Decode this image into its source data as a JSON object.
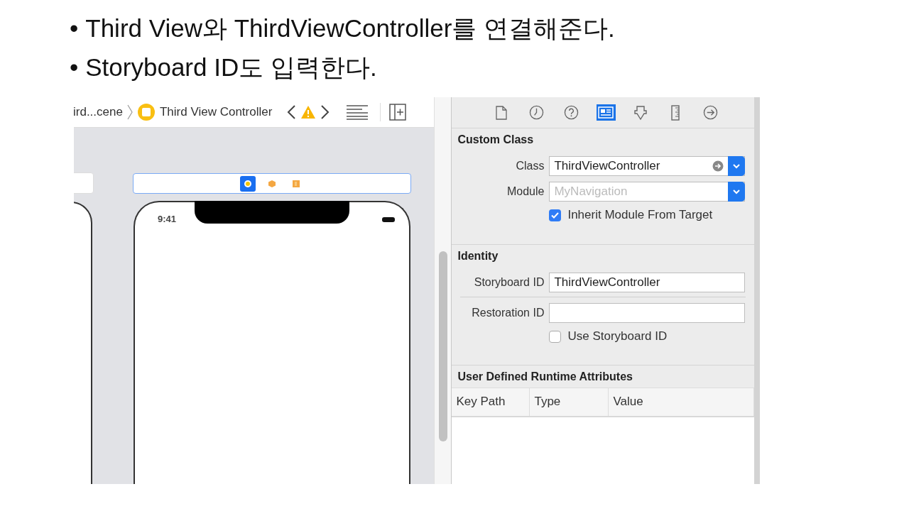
{
  "slide": {
    "bullets": [
      {
        "marker": "•",
        "text": "Third View와 ThirdViewController를 연결해준다."
      },
      {
        "marker": "•",
        "text": "Storyboard ID도 입력한다."
      }
    ]
  },
  "editor": {
    "breadcrumb": [
      "ird...cene",
      "Third View Controller"
    ],
    "dock": [
      {
        "kind": "controller",
        "selected": true
      },
      {
        "kind": "responder",
        "selected": false
      },
      {
        "kind": "exit",
        "selected": false
      }
    ],
    "clock": "9:41"
  },
  "inspector": {
    "tabs": [
      {
        "kind": "file",
        "selected": false
      },
      {
        "kind": "history",
        "selected": false
      },
      {
        "kind": "help",
        "selected": false
      },
      {
        "kind": "identity",
        "selected": true
      },
      {
        "kind": "attributes",
        "selected": false
      },
      {
        "kind": "size",
        "selected": false
      },
      {
        "kind": "connections",
        "selected": false
      }
    ],
    "custom_class": {
      "title": "Custom Class",
      "class_label": "Class",
      "class_value": "ThirdViewController",
      "module_label": "Module",
      "module_placeholder": "MyNavigation",
      "inherit": {
        "label": "Inherit Module From Target",
        "checked": true
      }
    },
    "identity": {
      "title": "Identity",
      "storyboard_id_label": "Storyboard ID",
      "storyboard_id": "ThirdViewController",
      "restoration_id_label": "Restoration ID",
      "use_storyboard": {
        "label": "Use Storyboard ID",
        "checked": false
      }
    },
    "runtime": {
      "title": "User Defined Runtime Attributes",
      "columns": [
        "Key Path",
        "Type",
        "Value"
      ]
    }
  }
}
